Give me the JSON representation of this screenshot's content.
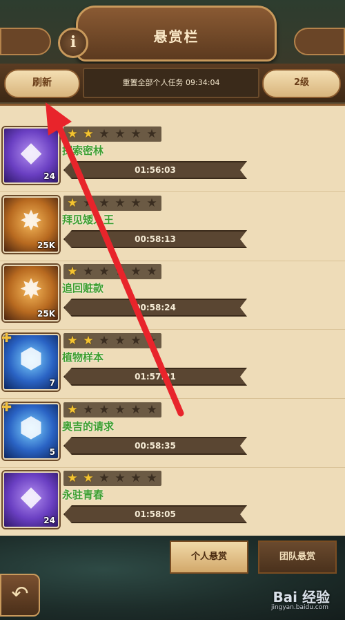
{
  "header": {
    "title": "悬赏栏",
    "info_glyph": "i",
    "refresh_label": "刷新",
    "reset_text": "重置全部个人任务 09:34:04",
    "level_label": "2级"
  },
  "tasks": [
    {
      "icon": "crystal-icon",
      "icon_color": "purple",
      "count": "24",
      "stars": 2,
      "name": "探索密林",
      "time": "01:56:03"
    },
    {
      "icon": "compass-icon",
      "icon_color": "gold",
      "count": "25K",
      "stars": 1,
      "name": "拜见矮人王",
      "time": "00:58:13"
    },
    {
      "icon": "compass-icon",
      "icon_color": "gold",
      "count": "25K",
      "stars": 1,
      "name": "追回赃款",
      "time": "00:58:24"
    },
    {
      "icon": "rune-stone-icon",
      "icon_color": "blue",
      "count": "7",
      "stars": 2,
      "name": "植物样本",
      "time": "01:57:21",
      "puzzle": true
    },
    {
      "icon": "rune-stone-icon",
      "icon_color": "blue",
      "count": "5",
      "stars": 1,
      "name": "奥吉的请求",
      "time": "00:58:35",
      "puzzle": true
    },
    {
      "icon": "crystal-icon",
      "icon_color": "purple",
      "count": "24",
      "stars": 2,
      "name": "永驻青春",
      "time": "01:58:05"
    }
  ],
  "bottom": {
    "tab_personal": "个人悬赏",
    "tab_team": "团队悬赏",
    "back_glyph": "↶"
  },
  "watermark": {
    "brand": "Bai 经验",
    "url": "jingyan.baidu.com"
  },
  "colors": {
    "arrow": "#e8242b",
    "task_name": "#3d9e2f",
    "star_on": "#f4c430"
  }
}
